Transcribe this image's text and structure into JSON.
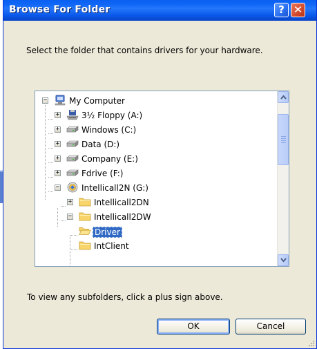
{
  "window": {
    "title": "Browse For Folder",
    "help_label": "?",
    "close_label": "✕"
  },
  "description": "Select the folder that contains drivers for your hardware.",
  "tree": {
    "items": [
      {
        "label": "My Computer",
        "toggle": "−",
        "icon": "computer-icon"
      },
      {
        "label": "3½ Floppy (A:)",
        "toggle": "+",
        "icon": "floppy-drive-icon"
      },
      {
        "label": "Windows (C:)",
        "toggle": "+",
        "icon": "hard-drive-icon"
      },
      {
        "label": "Data (D:)",
        "toggle": "+",
        "icon": "hard-drive-icon"
      },
      {
        "label": "Company (E:)",
        "toggle": "+",
        "icon": "hard-drive-icon"
      },
      {
        "label": "Fdrive (F:)",
        "toggle": "+",
        "icon": "hard-drive-icon"
      },
      {
        "label": "Intellicall2N (G:)",
        "toggle": "−",
        "icon": "network-drive-icon"
      },
      {
        "label": "Intellicall2DN",
        "toggle": "+",
        "icon": "folder-icon"
      },
      {
        "label": "Intellicall2DW",
        "toggle": "−",
        "icon": "folder-icon"
      },
      {
        "label": "Driver",
        "toggle": "",
        "icon": "folder-open-icon",
        "selected": true
      },
      {
        "label": "IntClient",
        "toggle": "",
        "icon": "folder-icon"
      }
    ]
  },
  "hint": "To view any subfolders, click a plus sign above.",
  "buttons": {
    "ok": "OK",
    "cancel": "Cancel"
  },
  "colors": {
    "title_bar": "#0a5fef",
    "selection": "#316ac5",
    "window_face": "#ece9d8"
  }
}
